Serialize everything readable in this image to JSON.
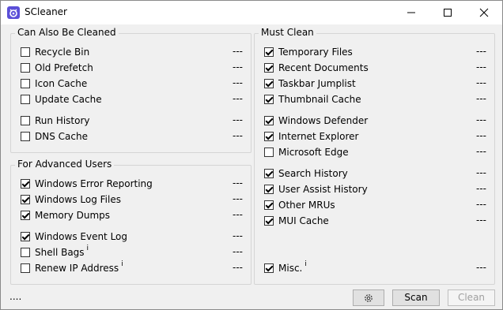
{
  "window": {
    "title": "SCleaner"
  },
  "groups": {
    "also": {
      "title": "Can Also Be Cleaned"
    },
    "advanced": {
      "title": "For Advanced Users"
    },
    "must": {
      "title": "Must Clean"
    }
  },
  "also_items": [
    {
      "label": "Recycle Bin",
      "checked": false,
      "status": "---"
    },
    {
      "label": "Old Prefetch",
      "checked": false,
      "status": "---"
    },
    {
      "label": "Icon Cache",
      "checked": false,
      "status": "---"
    },
    {
      "label": "Update Cache",
      "checked": false,
      "status": "---"
    },
    {
      "label": "Run History",
      "checked": false,
      "status": "---"
    },
    {
      "label": "DNS Cache",
      "checked": false,
      "status": "---"
    }
  ],
  "advanced_items": [
    {
      "label": "Windows Error Reporting",
      "checked": true,
      "status": "---"
    },
    {
      "label": "Windows Log Files",
      "checked": true,
      "status": "---"
    },
    {
      "label": "Memory Dumps",
      "checked": true,
      "status": "---"
    },
    {
      "label": "Windows Event Log",
      "checked": true,
      "status": "---"
    },
    {
      "label": "Shell Bags",
      "checked": false,
      "status": "---",
      "info": "i"
    },
    {
      "label": "Renew IP Address",
      "checked": false,
      "status": "---",
      "info": "i"
    }
  ],
  "must_items": [
    {
      "label": "Temporary Files",
      "checked": true,
      "status": "---"
    },
    {
      "label": "Recent Documents",
      "checked": true,
      "status": "---"
    },
    {
      "label": "Taskbar Jumplist",
      "checked": true,
      "status": "---"
    },
    {
      "label": "Thumbnail Cache",
      "checked": true,
      "status": "---"
    },
    {
      "label": "Windows Defender",
      "checked": true,
      "status": "---"
    },
    {
      "label": "Internet Explorer",
      "checked": true,
      "status": "---"
    },
    {
      "label": "Microsoft Edge",
      "checked": false,
      "status": "---"
    },
    {
      "label": "Search History",
      "checked": true,
      "status": "---"
    },
    {
      "label": "User Assist History",
      "checked": true,
      "status": "---"
    },
    {
      "label": "Other MRUs",
      "checked": true,
      "status": "---"
    },
    {
      "label": "MUI Cache",
      "checked": true,
      "status": "---"
    },
    {
      "label": "Misc.",
      "checked": true,
      "status": "---",
      "info": "i"
    }
  ],
  "footer": {
    "status": "....",
    "scan_label": "Scan",
    "clean_label": "Clean",
    "settings_icon": "gear-icon"
  },
  "colors": {
    "app_icon": "#5b4fd8"
  }
}
